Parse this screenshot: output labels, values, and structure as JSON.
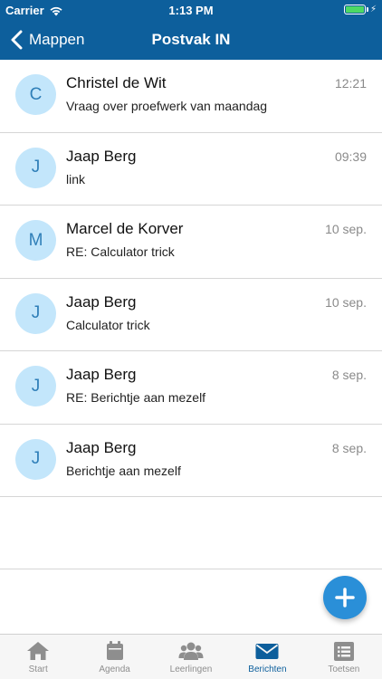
{
  "status_bar": {
    "carrier": "Carrier",
    "time": "1:13 PM",
    "battery_level": 1.0
  },
  "header": {
    "back_label": "Mappen",
    "title": "Postvak IN"
  },
  "messages": [
    {
      "initial": "C",
      "sender": "Christel de Wit",
      "subject": "Vraag over proefwerk van maandag",
      "time": "12:21"
    },
    {
      "initial": "J",
      "sender": "Jaap Berg",
      "subject": "link",
      "time": "09:39"
    },
    {
      "initial": "M",
      "sender": "Marcel de Korver",
      "subject": "RE: Calculator trick",
      "time": "10 sep."
    },
    {
      "initial": "J",
      "sender": "Jaap Berg",
      "subject": "Calculator trick",
      "time": "10 sep."
    },
    {
      "initial": "J",
      "sender": "Jaap Berg",
      "subject": "RE: Berichtje aan mezelf",
      "time": "8 sep."
    },
    {
      "initial": "J",
      "sender": "Jaap Berg",
      "subject": "Berichtje aan mezelf",
      "time": "8 sep."
    }
  ],
  "tabs": [
    {
      "label": "Start",
      "icon": "home-icon"
    },
    {
      "label": "Agenda",
      "icon": "calendar-icon"
    },
    {
      "label": "Leerlingen",
      "icon": "people-icon"
    },
    {
      "label": "Berichten",
      "icon": "envelope-icon",
      "active": true
    },
    {
      "label": "Toetsen",
      "icon": "list-icon"
    }
  ],
  "colors": {
    "header": "#0d5f9c",
    "avatar_bg": "#c3e6fb",
    "avatar_text": "#2f7fb8",
    "fab": "#2a8fd8",
    "tab_active": "#0d5f9c",
    "tab_inactive": "#8e8e8e"
  }
}
